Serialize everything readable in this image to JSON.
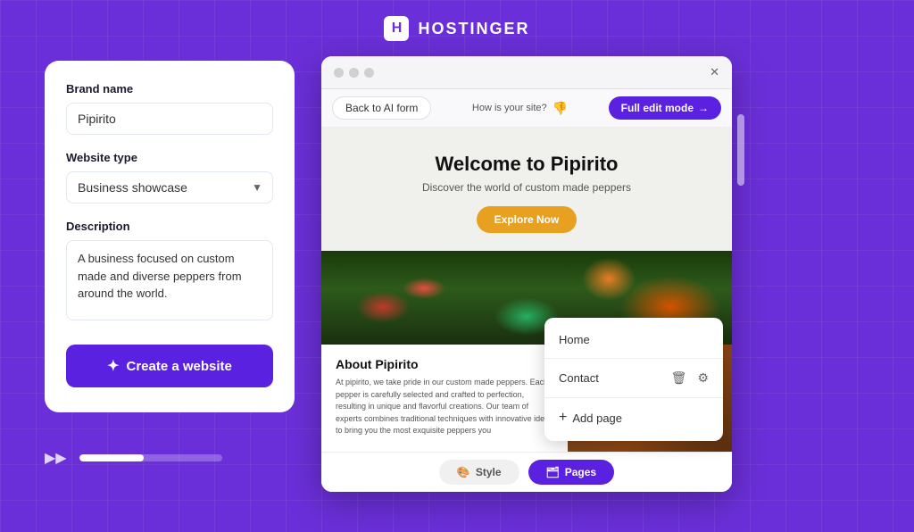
{
  "header": {
    "logo_letter": "H",
    "brand_name": "HOSTINGER"
  },
  "left_panel": {
    "brand_label": "Brand name",
    "brand_value": "Pipirito",
    "website_type_label": "Website type",
    "website_type_value": "Business showcase",
    "description_label": "Description",
    "description_value": "A business focused on custom made and diverse peppers from around the world.",
    "create_btn_label": "Create a website"
  },
  "browser": {
    "back_btn": "Back to AI form",
    "feedback_text": "How is your site?",
    "full_edit_btn": "Full edit mode",
    "site": {
      "title": "Welcome to Pipirito",
      "subtitle": "Discover the world of custom made peppers",
      "explore_btn": "Explore Now",
      "about_title": "About Pipirito",
      "about_text": "At pipirito, we take pride in our custom made peppers. Each pepper is carefully selected and crafted to perfection, resulting in unique and flavorful creations. Our team of experts combines traditional techniques with innovative ideas to bring you the most exquisite peppers you"
    },
    "context_menu": {
      "home_label": "Home",
      "contact_label": "Contact",
      "add_page_label": "Add page"
    },
    "tabs": {
      "style_label": "Style",
      "pages_label": "Pages"
    }
  },
  "progress": {
    "fill_percent": 45
  }
}
